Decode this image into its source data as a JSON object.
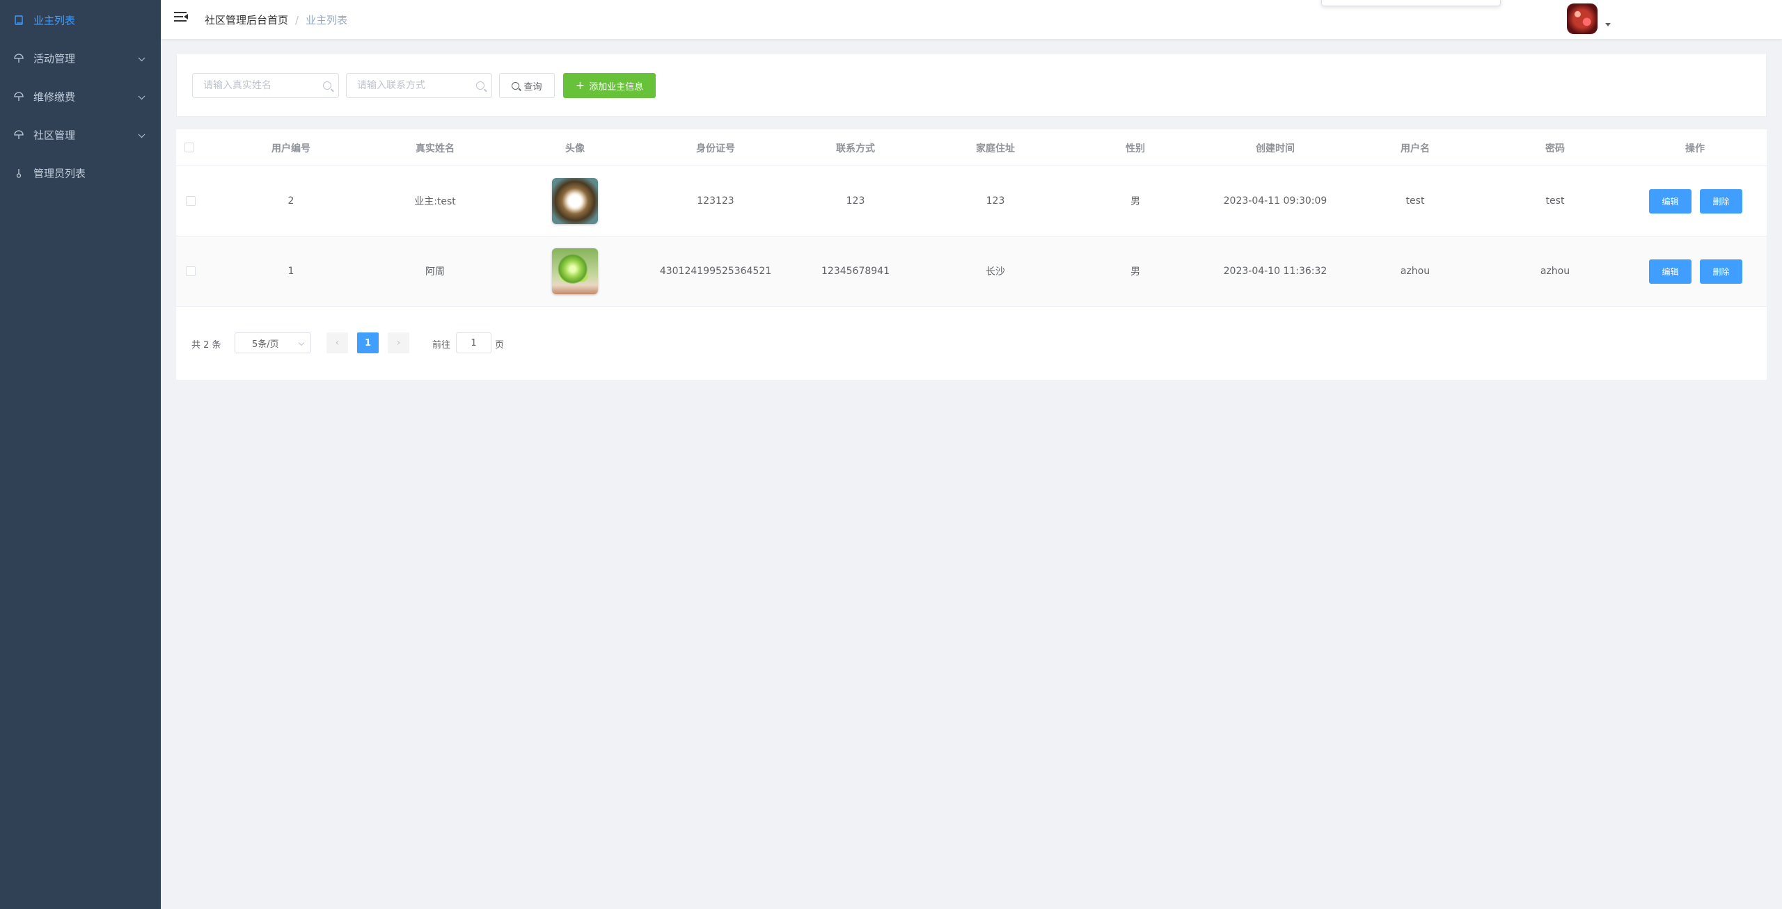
{
  "sidebar": {
    "items": [
      {
        "label": "业主列表",
        "icon": "book-icon",
        "active": true
      },
      {
        "label": "活动管理",
        "icon": "umbrella-icon",
        "has_submenu": true
      },
      {
        "label": "维修缴费",
        "icon": "umbrella-icon",
        "has_submenu": true
      },
      {
        "label": "社区管理",
        "icon": "umbrella-icon",
        "has_submenu": true
      },
      {
        "label": "管理员列表",
        "icon": "thermometer-icon"
      }
    ]
  },
  "header": {
    "breadcrumb_home": "社区管理后台首页",
    "breadcrumb_separator": "/",
    "breadcrumb_current": "业主列表"
  },
  "filters": {
    "name_placeholder": "请输入真实姓名",
    "phone_placeholder": "请输入联系方式",
    "query_label": "查询",
    "add_label": "添加业主信息"
  },
  "table": {
    "columns": [
      "用户编号",
      "真实姓名",
      "头像",
      "身份证号",
      "联系方式",
      "家庭住址",
      "性别",
      "创建时间",
      "用户名",
      "密码",
      "操作"
    ],
    "rows": [
      {
        "id": "2",
        "real_name": "业主:test",
        "id_card": "123123",
        "phone": "123",
        "address": "123",
        "gender": "男",
        "created": "2023-04-11 09:30:09",
        "username": "test",
        "password": "test"
      },
      {
        "id": "1",
        "real_name": "阿周",
        "id_card": "430124199525364521",
        "phone": "12345678941",
        "address": "长沙",
        "gender": "男",
        "created": "2023-04-10 11:36:32",
        "username": "azhou",
        "password": "azhou"
      }
    ],
    "edit_label": "编辑",
    "delete_label": "删除"
  },
  "pagination": {
    "total_text": "共 2 条",
    "page_size": "5条/页",
    "prev": "‹",
    "next": "›",
    "current_page": "1",
    "goto_label": "前往",
    "goto_value": "1",
    "page_suffix": "页"
  },
  "colors": {
    "sidebar_bg": "#304156",
    "primary": "#409eff",
    "success": "#67c23a"
  }
}
